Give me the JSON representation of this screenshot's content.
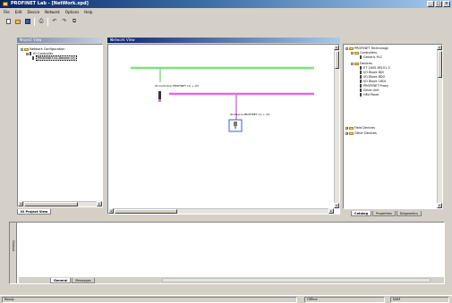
{
  "window": {
    "title": "PROFINET Lab - [NetWork.xpd]",
    "controls": [
      "_",
      "□",
      "×"
    ]
  },
  "menu": [
    "File",
    "Edit",
    "Device",
    "Network",
    "Options",
    "Help"
  ],
  "toolbar": {
    "icons": [
      "new-icon",
      "open-icon",
      "save-icon",
      "print-icon",
      "undo-icon",
      "redo-icon",
      "copy-icon"
    ]
  },
  "project_pane": {
    "header": "Project View",
    "close": "×",
    "tree": [
      {
        "expander": "-",
        "label": "Network Configuration"
      },
      {
        "expander": "+",
        "label": "IO-Controller"
      },
      {
        "expander": "",
        "label": "PROFINET IO-Device (1)"
      }
    ],
    "tab": "IO Project View"
  },
  "network_pane": {
    "header": "Network View",
    "close": "×",
    "controller_label": "IO-Controller PROFINET (1) + I/O",
    "device_label": "IO-Device PROFINET (1) + I/O"
  },
  "catalog_pane": {
    "header": "",
    "tree": [
      {
        "expander": "-",
        "label": "PROFINET Technology",
        "indent": 0
      },
      {
        "expander": "-",
        "label": "Controllers",
        "indent": 1
      },
      {
        "expander": "",
        "label": "Generic PLC",
        "indent": 2
      },
      {
        "expander": "-",
        "label": "Devices",
        "indent": 1
      },
      {
        "expander": "",
        "label": "ET 200S IM151-3",
        "indent": 2
      },
      {
        "expander": "",
        "label": "I/O Block 8DI",
        "indent": 2
      },
      {
        "expander": "",
        "label": "I/O Block 8DO",
        "indent": 2
      },
      {
        "expander": "",
        "label": "I/O Block 16DI",
        "indent": 2
      },
      {
        "expander": "",
        "label": "PROFINET Proxy",
        "indent": 2
      },
      {
        "expander": "",
        "label": "Drive Unit",
        "indent": 2
      },
      {
        "expander": "",
        "label": "HMI Panel",
        "indent": 2
      },
      {
        "expander": "+",
        "label": "Field Devices",
        "indent": 0
      },
      {
        "expander": "+",
        "label": "Other Devices",
        "indent": 0
      }
    ],
    "tabs": [
      "Catalog",
      "Properties",
      "Diagnostics"
    ]
  },
  "output_pane": {
    "side_label": "Output",
    "tabs": [
      "General",
      "Messages"
    ]
  },
  "statusbar": {
    "left": "Ready",
    "middle": "Offline",
    "right": "NUM"
  },
  "colors": {
    "bus_green": "#7be27b",
    "bus_magenta": "#e36ae3",
    "device_frame": "#3c5cc8"
  }
}
